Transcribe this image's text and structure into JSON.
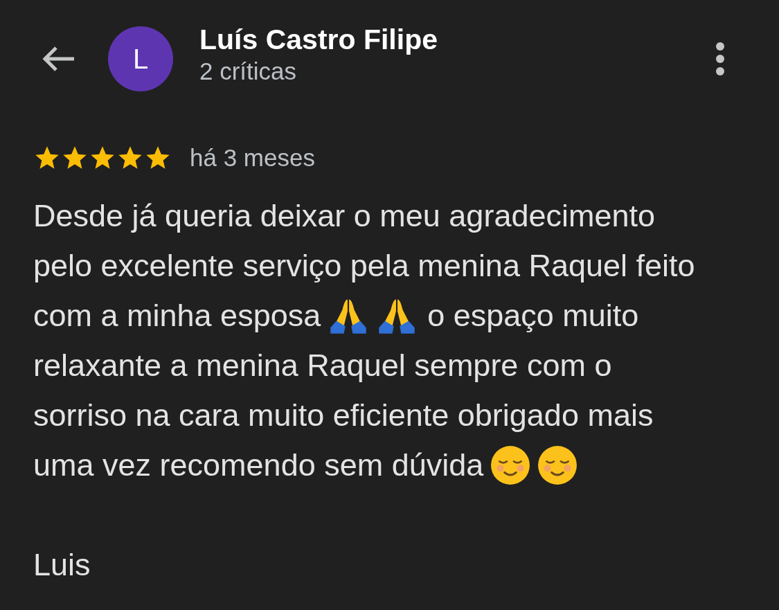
{
  "header": {
    "avatar_letter": "L",
    "name": "Luís Castro Filipe",
    "subtitle": "2 críticas"
  },
  "review": {
    "stars": 5,
    "time": "há 3 meses",
    "lines": [
      [
        {
          "kind": "text",
          "text": "Desde já queria deixar o meu agradecimento"
        }
      ],
      [
        {
          "kind": "text",
          "text": "pelo excelente serviço pela menina Raquel feito"
        }
      ],
      [
        {
          "kind": "text",
          "text": "com a minha esposa"
        },
        {
          "kind": "praying_hands"
        },
        {
          "kind": "praying_hands"
        },
        {
          "kind": "text",
          "text": "o espaço muito"
        }
      ],
      [
        {
          "kind": "text",
          "text": "relaxante a menina Raquel sempre com o"
        }
      ],
      [
        {
          "kind": "text",
          "text": "sorriso na cara muito eficiente obrigado mais"
        }
      ],
      [
        {
          "kind": "text",
          "text": "uma vez recomendo sem dúvida"
        },
        {
          "kind": "smiling_face"
        },
        {
          "kind": "smiling_face"
        }
      ]
    ],
    "signature": "Luis"
  }
}
